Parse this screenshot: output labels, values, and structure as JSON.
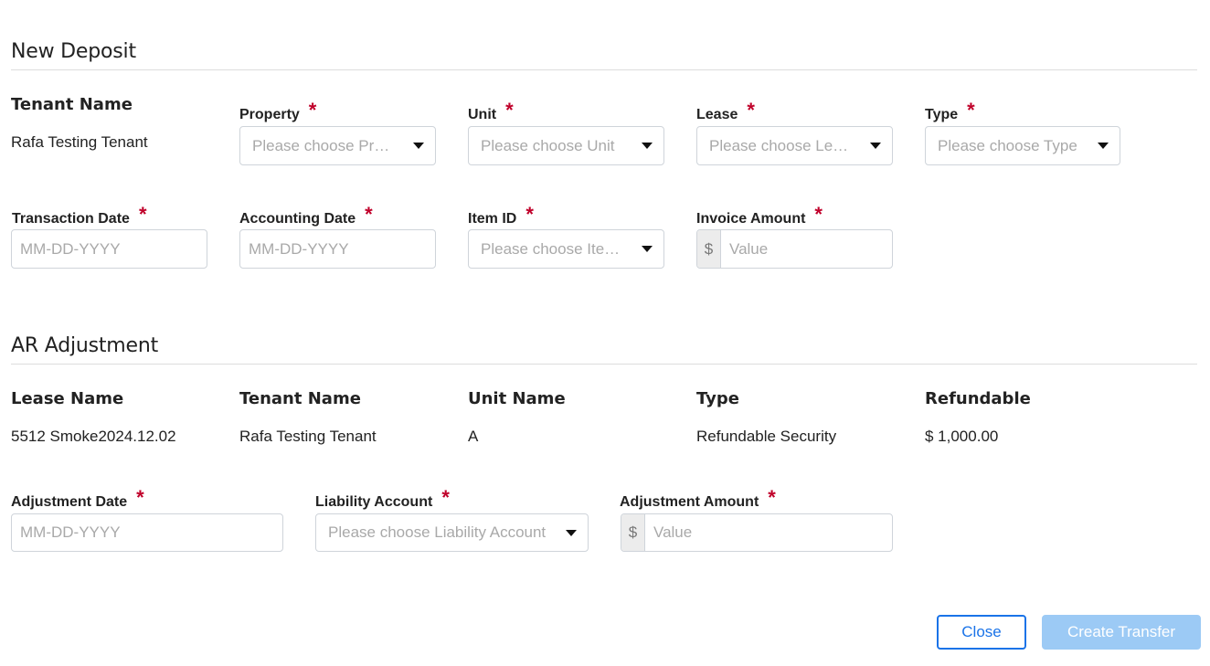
{
  "new_deposit": {
    "title": "New Deposit",
    "tenant_name": {
      "label": "Tenant Name",
      "value": "Rafa Testing Tenant"
    },
    "property": {
      "label": "Property",
      "placeholder": "Please choose Pr…"
    },
    "unit": {
      "label": "Unit",
      "placeholder": "Please choose Unit"
    },
    "lease": {
      "label": "Lease",
      "placeholder": "Please choose Le…"
    },
    "type": {
      "label": "Type",
      "placeholder": "Please choose Type"
    },
    "transaction_date": {
      "label": "Transaction Date",
      "placeholder": "MM-DD-YYYY"
    },
    "accounting_date": {
      "label": "Accounting Date",
      "placeholder": "MM-DD-YYYY"
    },
    "item_id": {
      "label": "Item ID",
      "placeholder": "Please choose Ite…"
    },
    "invoice_amount": {
      "label": "Invoice Amount",
      "prefix": "$",
      "placeholder": "Value"
    },
    "required_mark": "*"
  },
  "ar_adjustment": {
    "title": "AR Adjustment",
    "columns": [
      {
        "header": "Lease Name",
        "value": "5512 Smoke2024.12.02"
      },
      {
        "header": "Tenant Name",
        "value": "Rafa Testing Tenant"
      },
      {
        "header": "Unit Name",
        "value": "A"
      },
      {
        "header": "Type",
        "value": "Refundable Security"
      },
      {
        "header": "Refundable",
        "value": "$ 1,000.00"
      }
    ],
    "adjustment_date": {
      "label": "Adjustment Date",
      "placeholder": "MM-DD-YYYY"
    },
    "liability_account": {
      "label": "Liability Account",
      "placeholder": "Please choose Liability Account"
    },
    "adjustment_amount": {
      "label": "Adjustment Amount",
      "prefix": "$",
      "placeholder": "Value"
    }
  },
  "footer": {
    "close_label": "Close",
    "create_label": "Create Transfer"
  },
  "colors": {
    "required": "#c0002a",
    "primary": "#1a73e8",
    "primary_disabled": "#9ccaf5"
  }
}
